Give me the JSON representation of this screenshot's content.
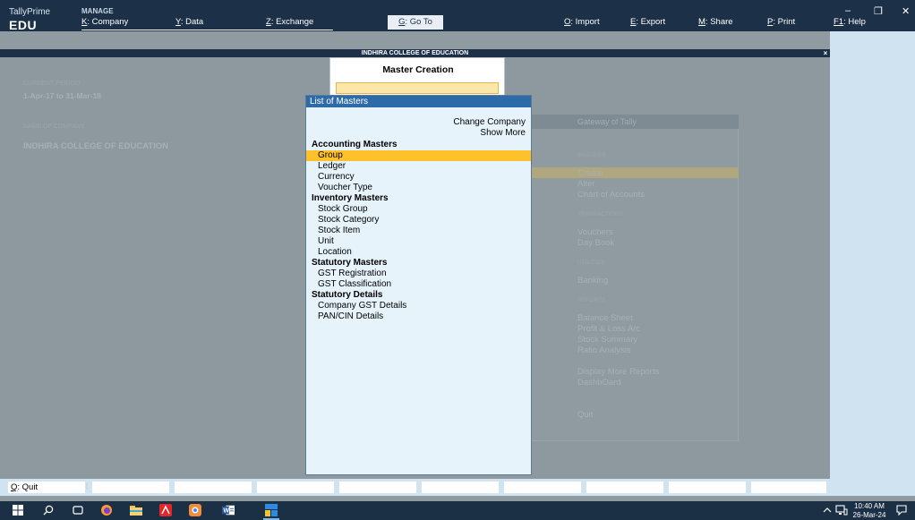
{
  "app": {
    "name": "TallyPrime",
    "edition": "EDU",
    "section_label": "MANAGE"
  },
  "menu": {
    "company": {
      "key": "K",
      "label": ": Company"
    },
    "data": {
      "key": "Y",
      "label": ": Data"
    },
    "exchange": {
      "key": "Z",
      "label": ": Exchange"
    },
    "goto": {
      "key": "G",
      "label": ": Go To"
    },
    "import": {
      "key": "O",
      "label": ": Import"
    },
    "export": {
      "key": "E",
      "label": ": Export"
    },
    "share": {
      "key": "M",
      "label": ": Share"
    },
    "print": {
      "key": "P",
      "label": ": Print"
    },
    "help": {
      "key": "F1",
      "label": ": Help"
    }
  },
  "window_controls": {
    "minimize": "–",
    "restore": "❐",
    "close": "✕"
  },
  "company_strip": {
    "name": "INDHIRA COLLEGE OF EDUCATION",
    "close": "×"
  },
  "gateway_background": {
    "current_period_label": "CURRENT PERIOD",
    "current_period": "1-Apr-17 to 31-Mar-18",
    "company_label": "NAME OF COMPANY",
    "company_name": "INDHIRA COLLEGE OF EDUCATION",
    "header": "Gateway of Tally",
    "masters_label": "MASTERS",
    "masters": [
      "Create",
      "Alter",
      "Chart of Accounts"
    ],
    "transactions_label": "TRANSACTIONS",
    "transactions": [
      "Vouchers",
      "Day Book"
    ],
    "utilities_label": "UTILITIES",
    "utilities": [
      "Banking"
    ],
    "reports_label": "REPORTS",
    "reports": [
      "Balance Sheet",
      "Profit & Loss A/c",
      "Stock Summary",
      "Ratio Analysis"
    ],
    "more": [
      "Display More Reports",
      "DashbOard"
    ],
    "quit": "Quit"
  },
  "master_creation": {
    "title": "Master Creation",
    "input_value": ""
  },
  "list_of_masters": {
    "title": "List of Masters",
    "change_company": "Change Company",
    "show_more": "Show More",
    "groups": [
      {
        "heading": "Accounting Masters",
        "items": [
          "Group",
          "Ledger",
          "Currency",
          "Voucher Type"
        ]
      },
      {
        "heading": "Inventory Masters",
        "items": [
          "Stock Group",
          "Stock Category",
          "Stock Item",
          "Unit",
          "Location"
        ]
      },
      {
        "heading": "Statutory Masters",
        "items": [
          "GST Registration",
          "GST Classification"
        ]
      },
      {
        "heading": "Statutory Details",
        "items": [
          "Company GST Details",
          "PAN/CIN Details"
        ]
      }
    ],
    "selected": "Group"
  },
  "bottom_bar": {
    "quit_key": "Q",
    "quit_label": ": Quit"
  },
  "taskbar": {
    "time": "10:40 AM",
    "date": "26-Mar-24"
  }
}
